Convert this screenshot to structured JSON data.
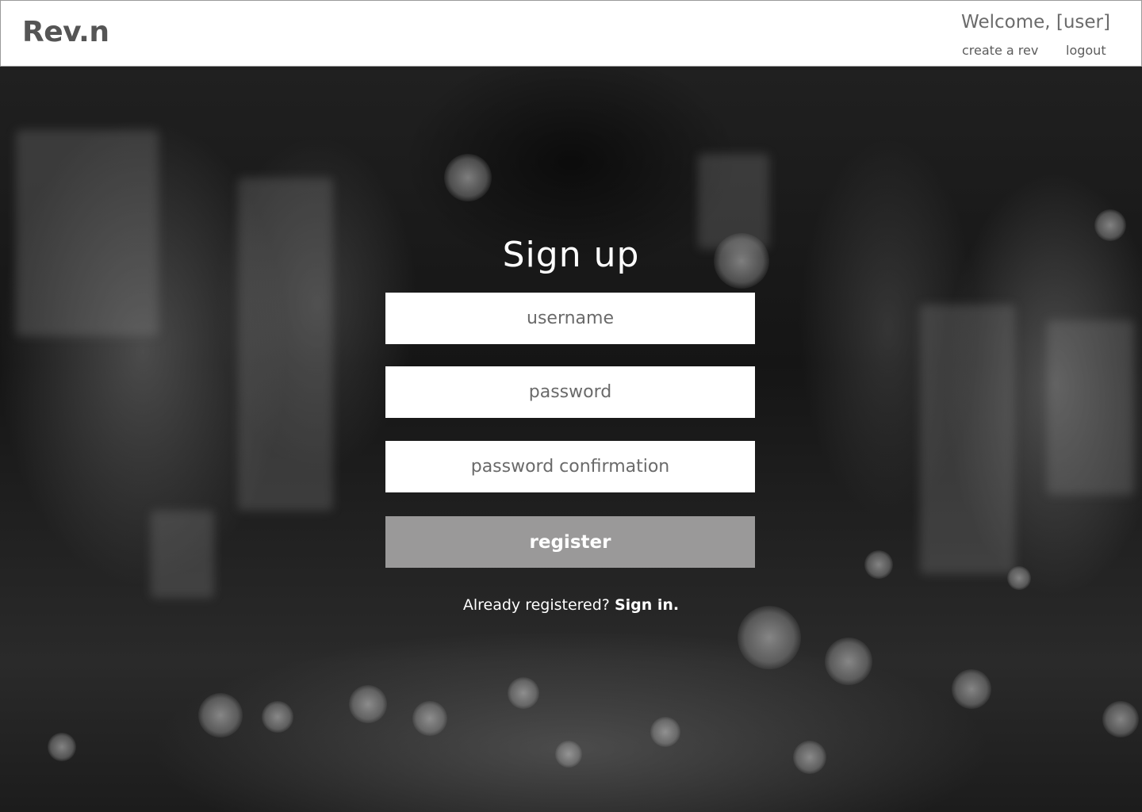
{
  "header": {
    "brand": "Rev.n",
    "welcome": "Welcome, [user]",
    "nav": {
      "create": "create a rev",
      "logout": "logout"
    }
  },
  "form": {
    "title": "Sign up",
    "username_placeholder": "username",
    "password_placeholder": "password",
    "confirmation_placeholder": "password confirmation",
    "register_label": "register",
    "signin_prompt": "Already registered?",
    "signin_link": "Sign in."
  },
  "colors": {
    "header_bg": "#ffffff",
    "brand_text": "#555555",
    "button_bg": "#9a9999",
    "field_bg": "#ffffff",
    "hero_tone": "grayscale"
  }
}
